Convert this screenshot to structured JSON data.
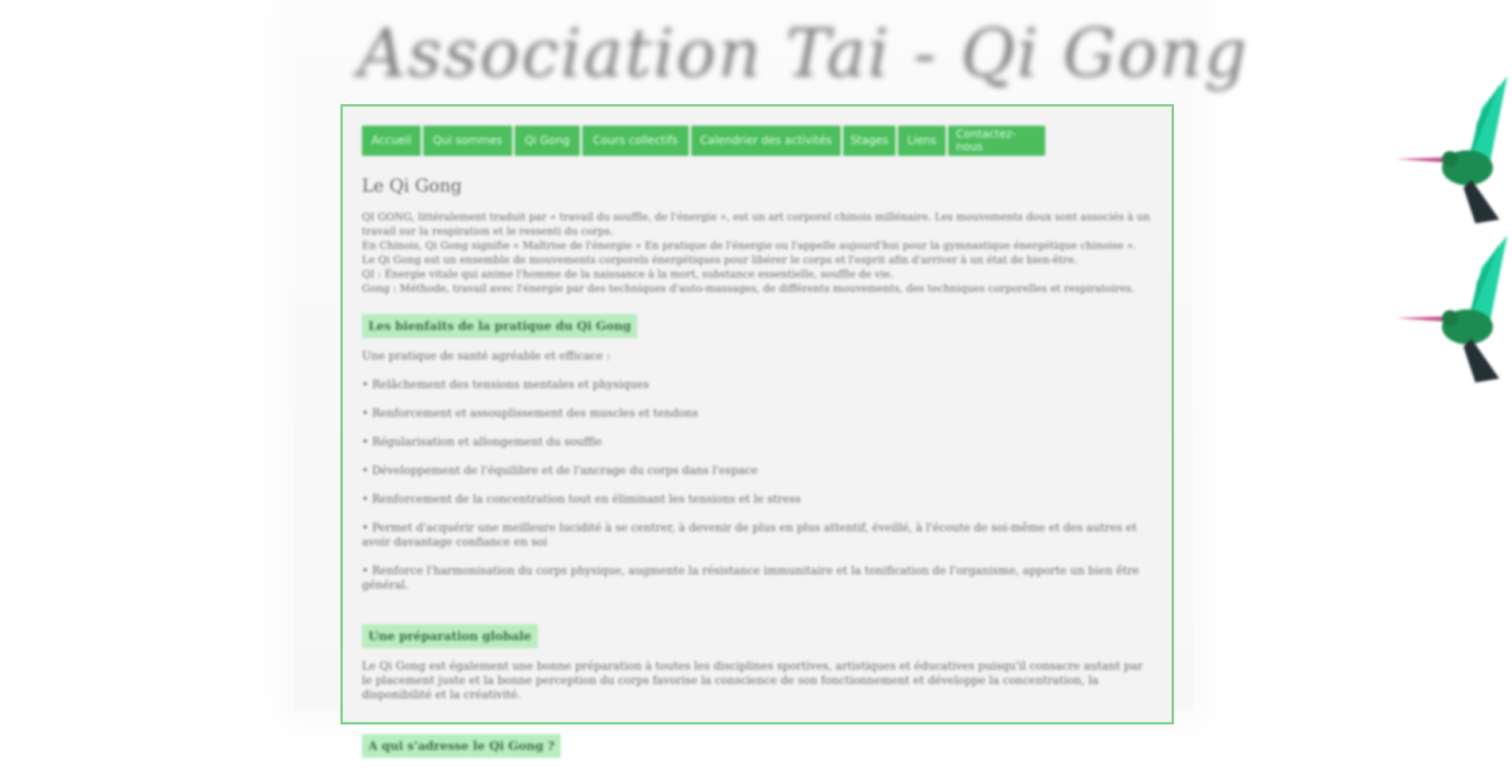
{
  "site": {
    "logo_text": "Association Tai - Qi Gong"
  },
  "nav": {
    "items": [
      "Accueil",
      "Qui sommes",
      "Qi Gong",
      "Cours collectifs",
      "Calendrier des activités",
      "Stages",
      "Liens",
      "Contactez-nous"
    ]
  },
  "content": {
    "title": "Le Qi Gong",
    "intro_lines": [
      "QI GONG, littéralement traduit par « travail du souffle, de l'énergie », est un art corporel chinois millénaire. Les mouvements doux sont associés à un",
      "travail sur la respiration et le ressenti du corps.",
      "En Chinois, Qi Gong signifie « Maîtrise de l'énergie » En pratique de l'énergie ou l'appelle aujourd'hui pour la gymnastique énergétique chinoise ».",
      "Le Qi Gong est un ensemble de mouvements corporels énergétiques pour libérer le corps et l'esprit afin d'arriver à un état de bien-être.",
      "QI : Énergie vitale qui anime l'homme de la naissance à la mort, substance essentielle, souffle de vie.",
      "Gong : Méthode, travail avec l'énergie par des techniques d'auto-massages, de différents mouvements, des techniques corporelles et respiratoires."
    ],
    "section1": {
      "heading": "Les bienfaits de la pratique du Qi Gong",
      "lead": "Une pratique de santé agréable et efficace :",
      "bullets": [
        "• Relâchement des tensions mentales et physiques",
        "• Renforcement et assouplissement des muscles et tendons",
        "• Régularisation et allongement du souffle",
        "• Développement de l'équilibre et de l'ancrage du corps dans l'espace",
        "• Renforcement de la concentration tout en éliminant les tensions et le stress",
        "• Permet d'acquérir une meilleure lucidité à se centrer, à devenir de plus en plus attentif, éveillé, à l'écoute de soi-même et des autres et avoir davantage confiance en soi",
        "• Renforce l'harmonisation du corps physique, augmente la résistance immunitaire et la tonification de l'organisme, apporte un bien être général."
      ]
    },
    "section2": {
      "heading": "Une préparation globale",
      "text": "Le Qi Gong est également une bonne préparation à toutes les disciplines sportives, artistiques et éducatives puisqu'il consacre autant par le placement juste et la bonne perception du corps favorise la conscience de son fonctionnement et développe la concentration, la disponibilité et la créativité."
    },
    "section3": {
      "heading": "A qui s'adresse le Qi Gong ?"
    }
  },
  "decor": {
    "accent": "#4cbe5e",
    "heading_bg": "#b9ecbf",
    "bird_icon": "hummingbird-icon"
  }
}
